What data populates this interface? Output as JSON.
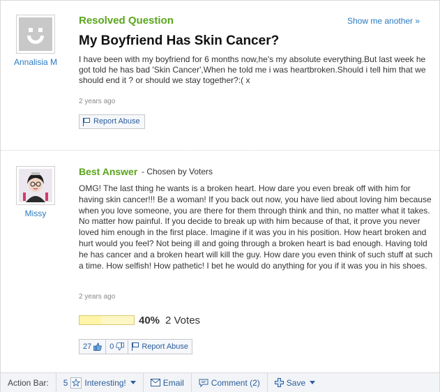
{
  "question": {
    "status_label": "Resolved Question",
    "show_another": "Show me another »",
    "title": "My Boyfriend Has Skin Cancer?",
    "body": "I have been with my boyfriend for 6 months now,he's my absolute everything.But last week he got told he has bad 'Skin Cancer',When he told me i was heartbroken.Should i tell him that we should end it ? or should we stay together?:( x",
    "time_ago": "2 years ago",
    "report_label": "Report Abuse",
    "asker": {
      "name": "Annalisia M",
      "avatar_icon": "default-smiley-avatar"
    }
  },
  "answer": {
    "label": "Best Answer",
    "chosen_by": "- Chosen by Voters",
    "body": "OMG! The last thing he wants is a broken heart. How dare you even break off with him for having skin cancer!!! Be a woman! If you back out now, you have lied about loving him because when you love someone, you are there for them through think and thin, no matter what it takes. No matter how painful. If you decide to break up with him because of that, it prove you never loved him enough in the first place. Imagine if it was you in his position. How heart broken and hurt would you feel? Not being ill and going through a broken heart is bad enough. Having told he has cancer and a broken heart will kill the guy. How dare you even think of such stuff at such a time. How selfish! How pathetic! I bet he would do anything for you if it was you in his shoes.",
    "time_ago": "2 years ago",
    "answerer": {
      "name": "Missy",
      "avatar_icon": "cartoon-girl-avatar"
    },
    "vote_percent_label": "40%",
    "vote_fraction": 0.4,
    "votes_label": "2 Votes",
    "thumbs_up_count": "27",
    "thumbs_down_count": "0",
    "report_label": "Report Abuse"
  },
  "action_bar": {
    "label": "Action Bar:",
    "interesting_count": "5",
    "interesting_label": "Interesting!",
    "email_label": "Email",
    "comment_label": "Comment (2)",
    "save_label": "Save"
  },
  "colors": {
    "accent_green": "#5aa51c",
    "link_blue": "#2a7ac0",
    "button_text_blue": "#2a5d9b"
  }
}
